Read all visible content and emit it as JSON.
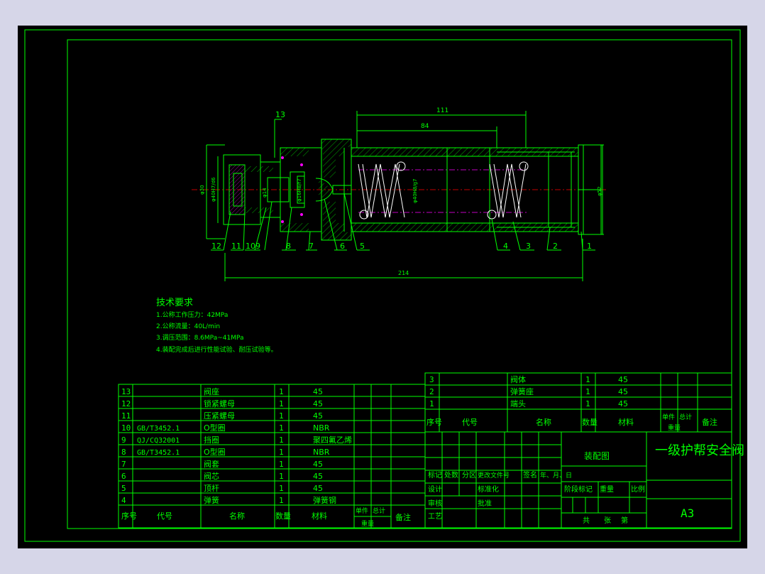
{
  "drawing": {
    "title": "一级护帮安全阀",
    "assembly_label": "装配图",
    "sheet_size": "A3"
  },
  "part_balloons": [
    "13",
    "12",
    "11",
    "10",
    "9",
    "8",
    "7",
    "6",
    "5",
    "4",
    "3",
    "2",
    "1"
  ],
  "dimensions": {
    "len_111": "111",
    "len_84": "84",
    "len_214": "214",
    "dia_left": "φ30",
    "dia_thread": "φ40H7/d6",
    "dia_small": "φ14",
    "dia_seat": "φ16H8/f7",
    "dia_bore": "φ40H8/g7",
    "dia_right": "φ52"
  },
  "tech_requirements": {
    "heading": "技术要求",
    "items": [
      "1.公称工作压力：42MPa",
      "2.公称流量：40L/min",
      "3.调压范围：8.6MPa~41MPa",
      "4.装配完成后进行性能试验、耐压试验等。"
    ]
  },
  "bom_left": {
    "rows": [
      {
        "no": "13",
        "code": "",
        "name": "阀座",
        "qty": "1",
        "material": "45"
      },
      {
        "no": "12",
        "code": "",
        "name": "锁紧螺母",
        "qty": "1",
        "material": "45"
      },
      {
        "no": "11",
        "code": "",
        "name": "压紧螺母",
        "qty": "1",
        "material": "45"
      },
      {
        "no": "10",
        "code": "GB/T3452.1",
        "name": "O型圈",
        "qty": "1",
        "material": "NBR"
      },
      {
        "no": "9",
        "code": "QJ/CQ32001",
        "name": "挡圈",
        "qty": "1",
        "material": "聚四氟乙烯"
      },
      {
        "no": "8",
        "code": "GB/T3452.1",
        "name": "O型圈",
        "qty": "1",
        "material": "NBR"
      },
      {
        "no": "7",
        "code": "",
        "name": "阀套",
        "qty": "1",
        "material": "45"
      },
      {
        "no": "6",
        "code": "",
        "name": "阀芯",
        "qty": "1",
        "material": "45"
      },
      {
        "no": "5",
        "code": "",
        "name": "顶杆",
        "qty": "1",
        "material": "45"
      },
      {
        "no": "4",
        "code": "",
        "name": "弹簧",
        "qty": "1",
        "material": "弹簧钢"
      }
    ],
    "header": {
      "no": "序号",
      "code": "代号",
      "name": "名称",
      "qty": "数量",
      "material": "材料",
      "unit_weight": "单件",
      "total_weight": "总计",
      "weight": "重量",
      "remark": "备注"
    }
  },
  "bom_right": {
    "rows": [
      {
        "no": "3",
        "name": "阀体",
        "qty": "1",
        "material": "45"
      },
      {
        "no": "2",
        "name": "弹簧座",
        "qty": "1",
        "material": "45"
      },
      {
        "no": "1",
        "name": "端头",
        "qty": "1",
        "material": "45"
      }
    ]
  },
  "title_block": {
    "mark": "标记",
    "count": "处数",
    "zone": "分区",
    "change_doc": "更改文件号",
    "signature": "签名",
    "date": "年、月、日",
    "design": "设计",
    "standardize": "标准化",
    "review": "审核",
    "process": "工艺",
    "approve": "批准",
    "stage_mark": "阶段标记",
    "weight": "重量",
    "scale": "比例",
    "total_sheets": "共",
    "sheets": "张",
    "sheet_no": "第"
  }
}
